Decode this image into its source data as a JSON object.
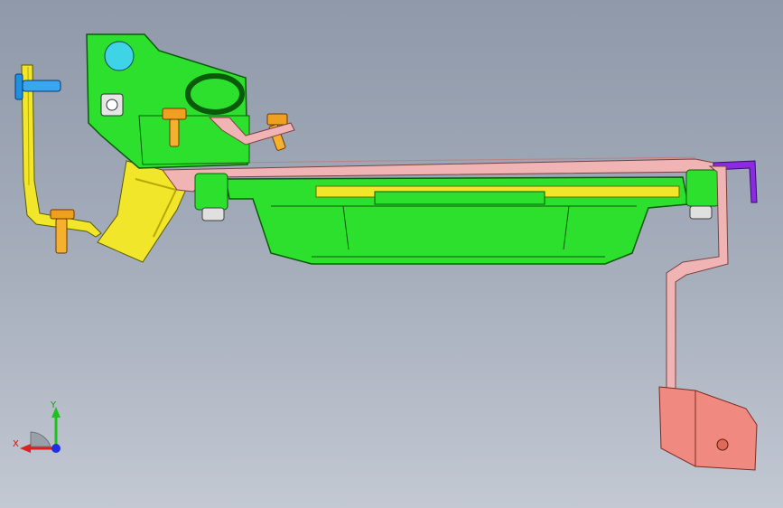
{
  "viewport": {
    "background_top": "#8f99a9",
    "background_bottom": "#c3c8d2"
  },
  "parts": {
    "main_bracket_color": "#2ee02e",
    "left_strap_color": "#f2e62a",
    "cross_bar_color": "#f0b4b4",
    "right_bracket_color": "#f08a80",
    "hook_color": "#8a2be2",
    "bolt_color": "#f0a020",
    "pin_color": "#1f8fe0",
    "round_hole_color": "#3fd3e6"
  },
  "triad": {
    "x_label": "X",
    "y_label": "Y",
    "x_color": "#e02020",
    "y_color": "#20c020",
    "z_color": "#2030e0"
  }
}
